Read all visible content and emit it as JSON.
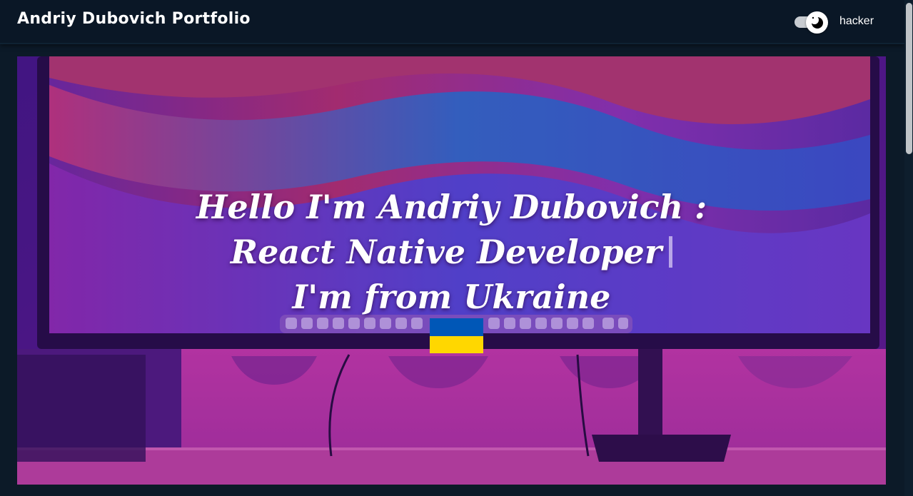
{
  "header": {
    "title": "Andriy Dubovich Portfolio",
    "theme_toggle": {
      "state": "on",
      "label": "hacker"
    }
  },
  "hero": {
    "greeting": "Hello I'm Andriy Dubovich :",
    "role": "React Native Developer",
    "origin": "I'm from Ukraine",
    "flag": {
      "top_color": "#0057b7",
      "bottom_color": "#ffd700"
    }
  },
  "colors": {
    "navbar_bg": "#0a1726",
    "page_bg": "#0c1a28",
    "text": "#ffffff"
  }
}
